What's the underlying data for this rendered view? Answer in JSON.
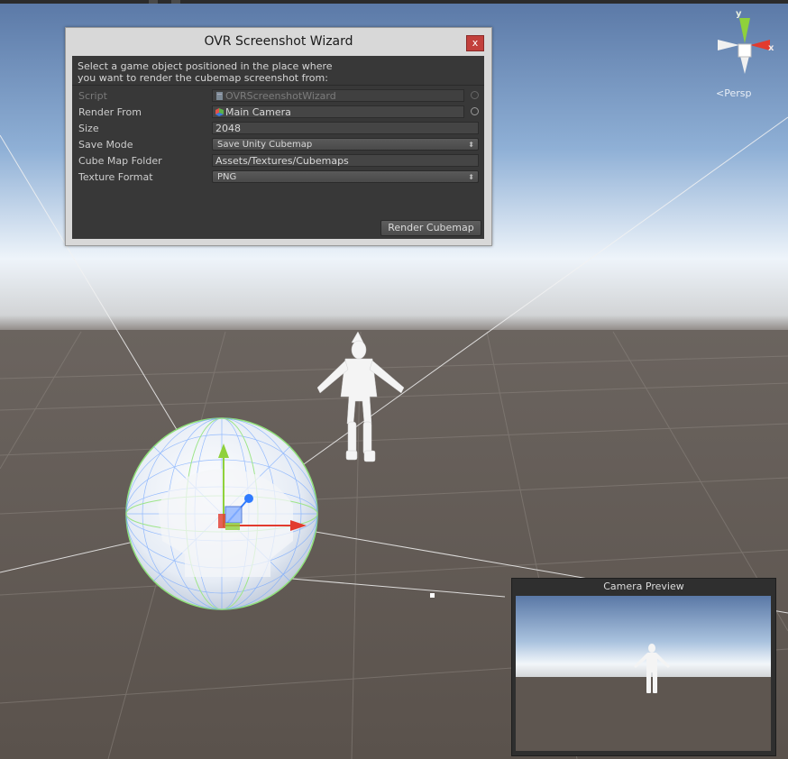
{
  "wizard": {
    "title": "OVR Screenshot Wizard",
    "close_label": "x",
    "help_line1": "Select a game object positioned in the place where",
    "help_line2": "you want to render the cubemap screenshot from:",
    "fields": {
      "script": {
        "label": "Script",
        "value": "OVRScreenshotWizard",
        "icon": "script-file-icon"
      },
      "render_from": {
        "label": "Render From",
        "value": "Main Camera",
        "icon": "gameobject-icon"
      },
      "size": {
        "label": "Size",
        "value": "2048"
      },
      "save_mode": {
        "label": "Save Mode",
        "value": "Save Unity Cubemap"
      },
      "cube_map_folder": {
        "label": "Cube Map Folder",
        "value": "Assets/Textures/Cubemaps"
      },
      "texture_format": {
        "label": "Texture Format",
        "value": "PNG"
      }
    },
    "render_button": "Render Cubemap"
  },
  "scene_gizmo": {
    "y_label": "y",
    "x_label": "x",
    "projection": "Persp",
    "colors": {
      "y": "#8fd13b",
      "x": "#e23b2e",
      "center": "#ffffff"
    }
  },
  "camera_preview": {
    "title": "Camera Preview"
  },
  "colors": {
    "sky_top": "#5a78a6",
    "horizon": "#f2f6fa",
    "ground": "#5b524c",
    "gizmo_green": "#8fd13b",
    "gizmo_red": "#e23b2e",
    "gizmo_blue": "#2f7bff"
  }
}
